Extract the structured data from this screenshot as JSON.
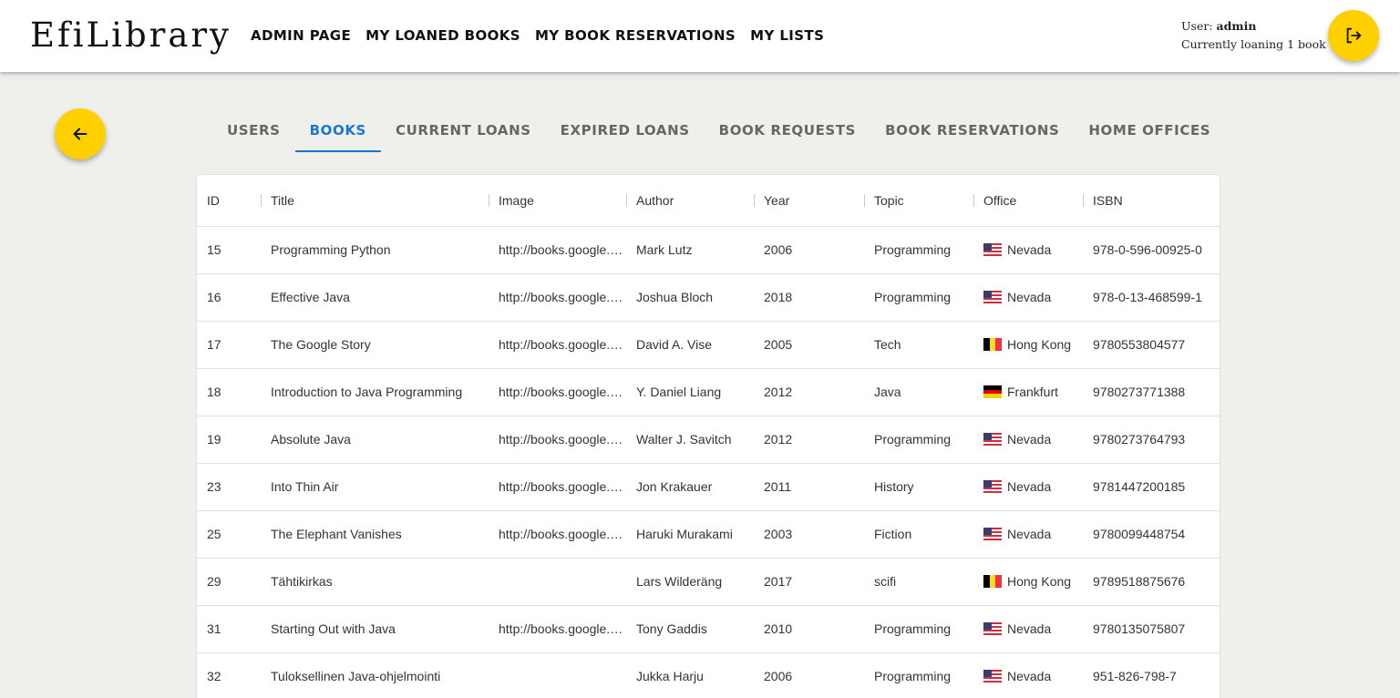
{
  "header": {
    "logo": "EfiLibrary",
    "nav": [
      {
        "label": "ADMIN PAGE"
      },
      {
        "label": "MY LOANED BOOKS"
      },
      {
        "label": "MY BOOK RESERVATIONS"
      },
      {
        "label": "MY LISTS"
      }
    ],
    "user_prefix": "User:",
    "user_name": "admin",
    "loan_status": "Currently loaning 1 book",
    "logout_icon": "logout-icon"
  },
  "back_icon": "arrow-left-icon",
  "tabs": [
    {
      "label": "USERS",
      "active": false
    },
    {
      "label": "BOOKS",
      "active": true
    },
    {
      "label": "CURRENT LOANS",
      "active": false
    },
    {
      "label": "EXPIRED LOANS",
      "active": false
    },
    {
      "label": "BOOK REQUESTS",
      "active": false
    },
    {
      "label": "BOOK RESERVATIONS",
      "active": false
    },
    {
      "label": "HOME OFFICES",
      "active": false
    }
  ],
  "table": {
    "columns": [
      "ID",
      "Title",
      "Image",
      "Author",
      "Year",
      "Topic",
      "Office",
      "ISBN"
    ],
    "rows": [
      {
        "id": "15",
        "title": "Programming Python",
        "image": "http://books.google.com",
        "author": "Mark Lutz",
        "year": "2006",
        "topic": "Programming",
        "flag": "us",
        "office": "Nevada",
        "isbn": "978-0-596-00925-0"
      },
      {
        "id": "16",
        "title": "Effective Java",
        "image": "http://books.google.com",
        "author": "Joshua Bloch",
        "year": "2018",
        "topic": "Programming",
        "flag": "us",
        "office": "Nevada",
        "isbn": "978-0-13-468599-1"
      },
      {
        "id": "17",
        "title": "The Google Story",
        "image": "http://books.google.com",
        "author": "David A. Vise",
        "year": "2005",
        "topic": "Tech",
        "flag": "be",
        "office": "Hong Kong",
        "isbn": "9780553804577"
      },
      {
        "id": "18",
        "title": "Introduction to Java Programming",
        "image": "http://books.google.com",
        "author": "Y. Daniel Liang",
        "year": "2012",
        "topic": "Java",
        "flag": "de",
        "office": "Frankfurt",
        "isbn": "9780273771388"
      },
      {
        "id": "19",
        "title": "Absolute Java",
        "image": "http://books.google.com",
        "author": "Walter J. Savitch",
        "year": "2012",
        "topic": "Programming",
        "flag": "us",
        "office": "Nevada",
        "isbn": "9780273764793"
      },
      {
        "id": "23",
        "title": "Into Thin Air",
        "image": "http://books.google.com",
        "author": "Jon Krakauer",
        "year": "2011",
        "topic": "History",
        "flag": "us",
        "office": "Nevada",
        "isbn": "9781447200185"
      },
      {
        "id": "25",
        "title": "The Elephant Vanishes",
        "image": "http://books.google.com",
        "author": "Haruki Murakami",
        "year": "2003",
        "topic": "Fiction",
        "flag": "us",
        "office": "Nevada",
        "isbn": "9780099448754"
      },
      {
        "id": "29",
        "title": "Tähtikirkas",
        "image": "",
        "author": "Lars Wilderäng",
        "year": "2017",
        "topic": "scifi",
        "flag": "be",
        "office": "Hong Kong",
        "isbn": "9789518875676"
      },
      {
        "id": "31",
        "title": "Starting Out with Java",
        "image": "http://books.google.com",
        "author": "Tony Gaddis",
        "year": "2010",
        "topic": "Programming",
        "flag": "us",
        "office": "Nevada",
        "isbn": "9780135075807"
      },
      {
        "id": "32",
        "title": "Tuloksellinen Java-ohjelmointi",
        "image": "",
        "author": "Jukka Harju",
        "year": "2006",
        "topic": "Programming",
        "flag": "us",
        "office": "Nevada",
        "isbn": "951-826-798-7"
      }
    ]
  },
  "colors": {
    "accent": "#ffd000",
    "active_tab": "#1976d2",
    "background": "#efefeb"
  }
}
